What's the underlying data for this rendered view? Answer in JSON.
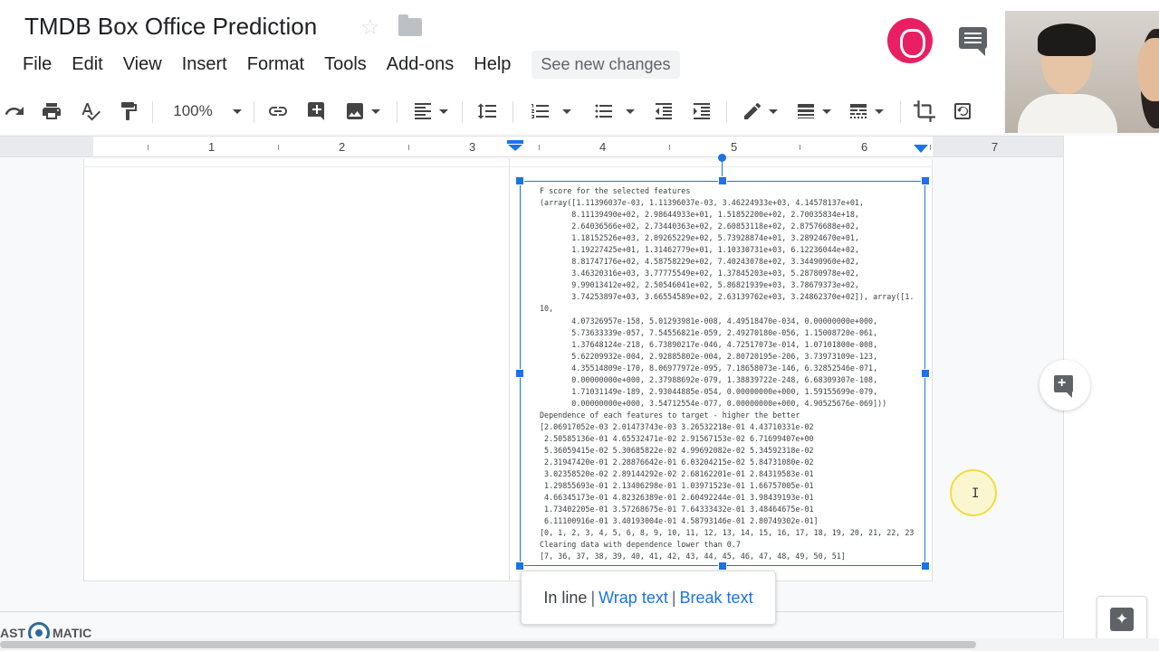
{
  "header": {
    "title": "TMDB Box Office Prediction",
    "star": "☆"
  },
  "menu": {
    "items": [
      "File",
      "Edit",
      "View",
      "Insert",
      "Format",
      "Tools",
      "Add-ons",
      "Help"
    ],
    "see_changes": "See new changes"
  },
  "toolbar": {
    "zoom": "100%"
  },
  "ruler": {
    "numbers": [
      "1",
      "2",
      "3",
      "4",
      "5",
      "6",
      "7"
    ]
  },
  "image_code": {
    "lines": [
      "F score for the selected features",
      "(array([1.11396037e-03, 1.11396037e-03, 3.46224933e+03, 4.14578137e+01,",
      "       8.11139490e+02, 2.98644933e+01, 1.51852200e+02, 2.70035834e+18,",
      "       2.64036566e+02, 2.73440363e+02, 2.60853118e+02, 2.87576688e+02,",
      "       1.18152526e+03, 2.09265229e+02, 5.73928874e+01, 3.28924670e+01,",
      "       1.19227425e+01, 1.31462779e+01, 1.10330731e+03, 6.12236044e+02,",
      "       8.81747176e+02, 4.58758229e+02, 7.40243078e+02, 3.34490960e+02,",
      "       3.46320316e+03, 3.77775549e+02, 1.37845203e+03, 5.28780978e+02,",
      "       9.99013412e+02, 2.50546041e+02, 5.86821939e+03, 3.78679373e+02,",
      "       3.74253897e+03, 3.66554589e+02, 2.63139762e+03, 3.24862370e+02]), array([1.",
      "10,",
      "       4.07326957e-158, 5.01293981e-008, 4.49518470e-034, 0.00000000e+000,",
      "       5.73633339e-057, 7.54556821e-059, 2.49270180e-056, 1.15008720e-061,",
      "       1.37648124e-218, 6.73890217e-046, 4.72517073e-014, 1.07101800e-008,",
      "       5.62209932e-004, 2.92885802e-004, 2.80720195e-206, 3.73973109e-123,",
      "       4.35514809e-170, 8.06977972e-095, 7.18658073e-146, 6.32852546e-071,",
      "       0.00000000e+000, 2.37988692e-079, 1.38839722e-248, 6.68309307e-108,",
      "       1.71031149e-189, 2.93044885e-054, 0.00000000e+000, 1.59155699e-079,",
      "       0.00000000e+000, 3.54712554e-077, 0.00000000e+000, 4.90525676e-069]))",
      "Dependence of each features to target - higher the better",
      "[2.06917052e-03 2.01473743e-03 3.26532218e-01 4.43710331e-02",
      " 2.50585136e-01 4.65532471e-02 2.91567153e-02 6.71699407e+00",
      " 5.36059415e-02 5.30685822e-02 4.99692082e-02 5.34592318e-02",
      " 2.31947420e-01 2.28876642e-01 6.03204215e-02 5.84731080e-02",
      " 3.02358520e-02 2.89144292e-02 2.68162201e-01 2.84319583e-01",
      " 1.29855693e-01 2.13406298e-01 1.03971523e-01 1.66757005e-01",
      " 4.66345173e-01 4.82326389e-01 2.60492244e-01 3.98439193e-01",
      " 1.73402205e-01 3.57268675e-01 7.64333432e-01 3.48464675e-01",
      " 6.11100916e-01 3.40193004e-01 4.58793146e-01 2.80749302e-01]",
      "[0, 1, 2, 3, 4, 5, 6, 8, 9, 10, 11, 12, 13, 14, 15, 16, 17, 18, 19, 20, 21, 22, 23",
      "Clearing data with dependence lower than 0.7",
      "[7, 36, 37, 38, 39, 40, 41, 42, 43, 44, 45, 46, 47, 48, 49, 50, 51]"
    ]
  },
  "wrap_popup": {
    "inline": "In line",
    "wrap": "Wrap text",
    "break": "Break text",
    "sep": "|"
  },
  "cursor": "I",
  "watermark": {
    "left": "AST",
    "right": "MATIC"
  }
}
